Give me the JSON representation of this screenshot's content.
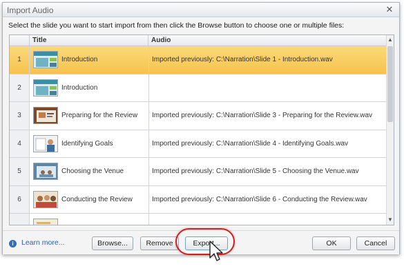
{
  "window": {
    "title": "Import Audio"
  },
  "instruction": "Select the slide you want to start import from then click the Browse button to choose one or multiple files:",
  "columns": {
    "title": "Title",
    "audio": "Audio"
  },
  "rows": [
    {
      "num": "1",
      "title": "Introduction",
      "audio": "Imported previously: C:\\Narration\\Slide 1 - Introduction.wav",
      "selected": true
    },
    {
      "num": "2",
      "title": "Introduction",
      "audio": "",
      "selected": false
    },
    {
      "num": "3",
      "title": "Preparing for the Review",
      "audio": "Imported previously: C:\\Narration\\Slide 3 - Preparing for the Review.wav",
      "selected": false
    },
    {
      "num": "4",
      "title": "Identifying Goals",
      "audio": "Imported previously: C:\\Narration\\Slide 4 - Identifying Goals.wav",
      "selected": false
    },
    {
      "num": "5",
      "title": "Choosing the Venue",
      "audio": "Imported previously: C:\\Narration\\Slide 5 - Choosing the Venue.wav",
      "selected": false
    },
    {
      "num": "6",
      "title": "Conducting the Review",
      "audio": "Imported previously: C:\\Narration\\Slide 6 - Conducting the Review.wav",
      "selected": false
    }
  ],
  "footer": {
    "learn_more": "Learn more...",
    "browse": "Browse...",
    "remove": "Remove",
    "export": "Export...",
    "ok": "OK",
    "cancel": "Cancel"
  },
  "icons": {
    "close": "close-icon",
    "info": "info-icon",
    "cursor": "arrow-cursor-icon"
  },
  "colors": {
    "selected_row": "#f6c34c",
    "highlight_ring": "#cc1f1f",
    "link": "#2a5ea8"
  }
}
